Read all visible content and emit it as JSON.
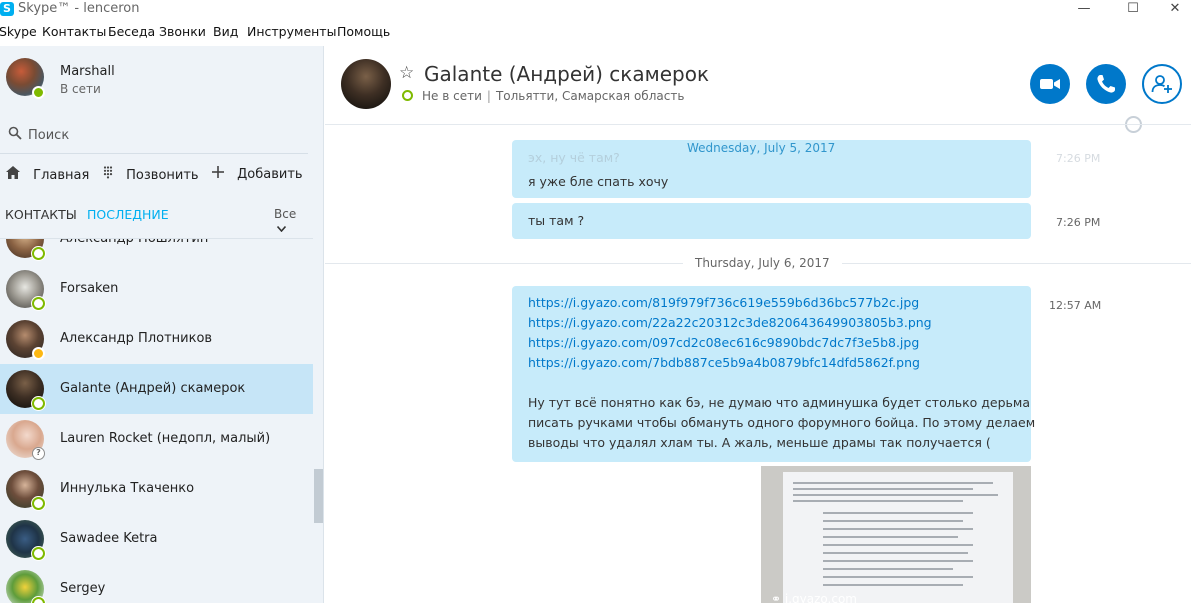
{
  "window": {
    "title": "Skype™ - lenceron",
    "logo_letter": "S",
    "minimize": "—",
    "maximize": "☐",
    "close": "✕"
  },
  "menu": [
    "Skype",
    "Контакты",
    "Беседа",
    "Звонки",
    "Вид",
    "Инструменты",
    "Помощь"
  ],
  "profile": {
    "name": "Marshall",
    "status": "В сети"
  },
  "search": {
    "placeholder": "Поиск",
    "icon": "search-icon"
  },
  "nav": {
    "home": "Главная",
    "call": "Позвонить",
    "add": "Добавить"
  },
  "tabs": {
    "contacts": "КОНТАКТЫ",
    "recent": "ПОСЛЕДНИЕ",
    "filter": "Все"
  },
  "contacts": [
    {
      "name": "Александр Пошлятин",
      "presence": "online"
    },
    {
      "name": "Forsaken",
      "presence": "online"
    },
    {
      "name": "Александр Плотников",
      "presence": "away"
    },
    {
      "name": "Galante (Андрей) скамерок",
      "presence": "online",
      "selected": true
    },
    {
      "name": "Lauren Rocket (недопл, малый)",
      "presence": "unknown"
    },
    {
      "name": "Иннулька Ткаченко",
      "presence": "online"
    },
    {
      "name": "Sawadee Ketra",
      "presence": "online"
    },
    {
      "name": "Sergey",
      "presence": "online"
    }
  ],
  "chat": {
    "title": "Galante (Андрей) скамерок",
    "status": "Не в сети",
    "location": "Тольятти, Самарская область"
  },
  "colors": {
    "accent": "#00aff0",
    "button": "#0078ca",
    "bubble": "#c7ebfa",
    "selected": "#c6e5f7"
  },
  "messages": {
    "faded_text": "эх, ну чё там?",
    "faded_time": "7:26 PM",
    "date1": "Wednesday, July 5, 2017",
    "msg1": "я уже бле спать хочу",
    "msg2": "ты там ?",
    "msg2_time": "7:26 PM",
    "date2": "Thursday, July 6, 2017",
    "msg3_time": "12:57 AM",
    "links": [
      "https://i.gyazo.com/819f979f736c619e559b6d36bc577b2c.jpg",
      "https://i.gyazo.com/22a22c20312c3de820643649903805b3.png",
      "https://i.gyazo.com/097cd2c08ec616c9890bdc7dc7f3e5b8.jpg",
      "https://i.gyazo.com/7bdb887ce5b9a4b0879bfc14dfd5862f.png"
    ],
    "paragraph_lines": [
      "Ну тут всё понятно как бэ, не думаю что админушка будет столько дерьма",
      "писать ручками чтобы обмануть одного форумного бойца. По этому делаем",
      "выводы что удалял хлам ты. А жаль, меньше драмы так получается ("
    ],
    "image_caption": "i.gyazo.com"
  }
}
